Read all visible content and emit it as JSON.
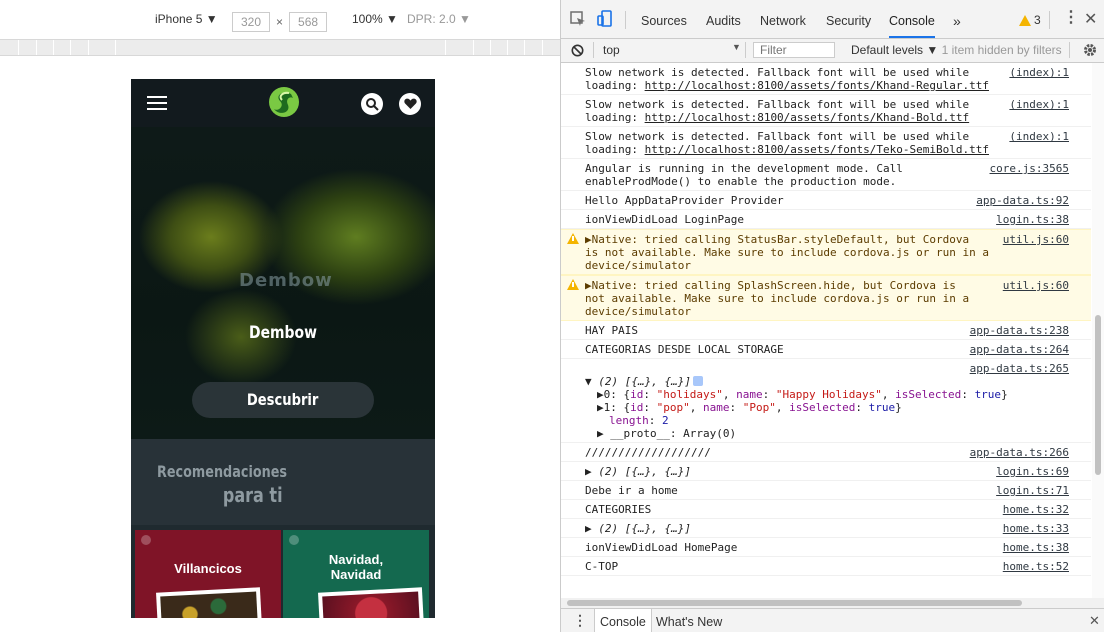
{
  "device_toolbar": {
    "device": "iPhone 5 ▼",
    "width": "320",
    "times": "×",
    "height": "568",
    "zoom": "100% ▼",
    "dpr": "DPR: 2.0 ▼"
  },
  "app": {
    "hero_watermark": "Dembow",
    "hero_title": "Dembow",
    "discover_label": "Descubrir",
    "recs_line1": "Recomendaciones",
    "recs_line2": "para ti",
    "cards": [
      {
        "title": "Villancicos",
        "color": "#7f1427"
      },
      {
        "title_line1": "Navidad,",
        "title_line2": "Navidad",
        "color": "#14694f"
      }
    ]
  },
  "devtools": {
    "tabs": [
      "Sources",
      "Audits",
      "Network",
      "Security",
      "Console"
    ],
    "active_tab": "Console",
    "more": "»",
    "warning_count": "3",
    "context": "top",
    "filter_placeholder": "Filter",
    "levels": "Default levels ▼",
    "hidden": "1 item hidden by filters",
    "drawer_tabs": [
      "Console",
      "What's New"
    ],
    "accent": "#1a73e8",
    "warn_color": "#f4b400"
  },
  "console": [
    {
      "type": "log",
      "text": "Slow network is detected. Fallback font will be used while",
      "text2": "loading: ",
      "link": "http://localhost:8100/assets/fonts/Khand-Regular.ttf",
      "src": "(index):1"
    },
    {
      "type": "log",
      "text": "Slow network is detected. Fallback font will be used while",
      "text2": "loading: ",
      "link": "http://localhost:8100/assets/fonts/Khand-Bold.ttf",
      "src": "(index):1"
    },
    {
      "type": "log",
      "text": "Slow network is detected. Fallback font will be used while",
      "text2": "loading: ",
      "link": "http://localhost:8100/assets/fonts/Teko-SemiBold.ttf",
      "src": "(index):1"
    },
    {
      "type": "log",
      "text": "Angular is running in the development mode. Call",
      "text2": "enableProdMode() to enable the production mode.",
      "src": "core.js:3565"
    },
    {
      "type": "log",
      "text": "Hello AppDataProvider Provider",
      "src": "app-data.ts:92"
    },
    {
      "type": "log",
      "text": "ionViewDidLoad LoginPage",
      "src": "login.ts:38"
    },
    {
      "type": "warn",
      "text": "▶Native: tried calling StatusBar.styleDefault, but Cordova",
      "text2": "is not available. Make sure to include cordova.js or run in a",
      "text3": "device/simulator",
      "src": "util.js:60"
    },
    {
      "type": "warn",
      "text": "▶Native: tried calling SplashScreen.hide, but Cordova is",
      "text2": "not available. Make sure to include cordova.js or run in a",
      "text3": "device/simulator",
      "src": "util.js:60"
    },
    {
      "type": "log",
      "text": "HAY PAIS",
      "src": "app-data.ts:238"
    },
    {
      "type": "log",
      "text": "CATEGORIAS DESDE LOCAL STORAGE",
      "src": "app-data.ts:264"
    },
    {
      "type": "obj",
      "src": "app-data.ts:265",
      "head": "▼ (2) [{…}, {…}]",
      "rows": [
        {
          "prefix": "▶0: ",
          "id": "\"holidays\"",
          "name": "\"Happy Holidays\"",
          "sel": "true"
        },
        {
          "prefix": "▶1: ",
          "id": "\"pop\"",
          "name": "\"Pop\"",
          "sel": "true"
        }
      ],
      "length_key": "length",
      "length_val": "2",
      "proto": "▶ __proto__: Array(0)"
    },
    {
      "type": "log",
      "text": "///////////////////",
      "src": "app-data.ts:266"
    },
    {
      "type": "log",
      "italic": true,
      "text": "▶ (2) [{…}, {…}]",
      "src": "login.ts:69"
    },
    {
      "type": "log",
      "text": "Debe ir a home",
      "src": "login.ts:71"
    },
    {
      "type": "log",
      "text": "CATEGORIES",
      "src": "home.ts:32"
    },
    {
      "type": "log",
      "italic": true,
      "text": "▶ (2) [{…}, {…}]",
      "src": "home.ts:33"
    },
    {
      "type": "log",
      "text": "ionViewDidLoad HomePage",
      "src": "home.ts:38"
    },
    {
      "type": "log",
      "text": "C-TOP",
      "src": "home.ts:52"
    }
  ]
}
